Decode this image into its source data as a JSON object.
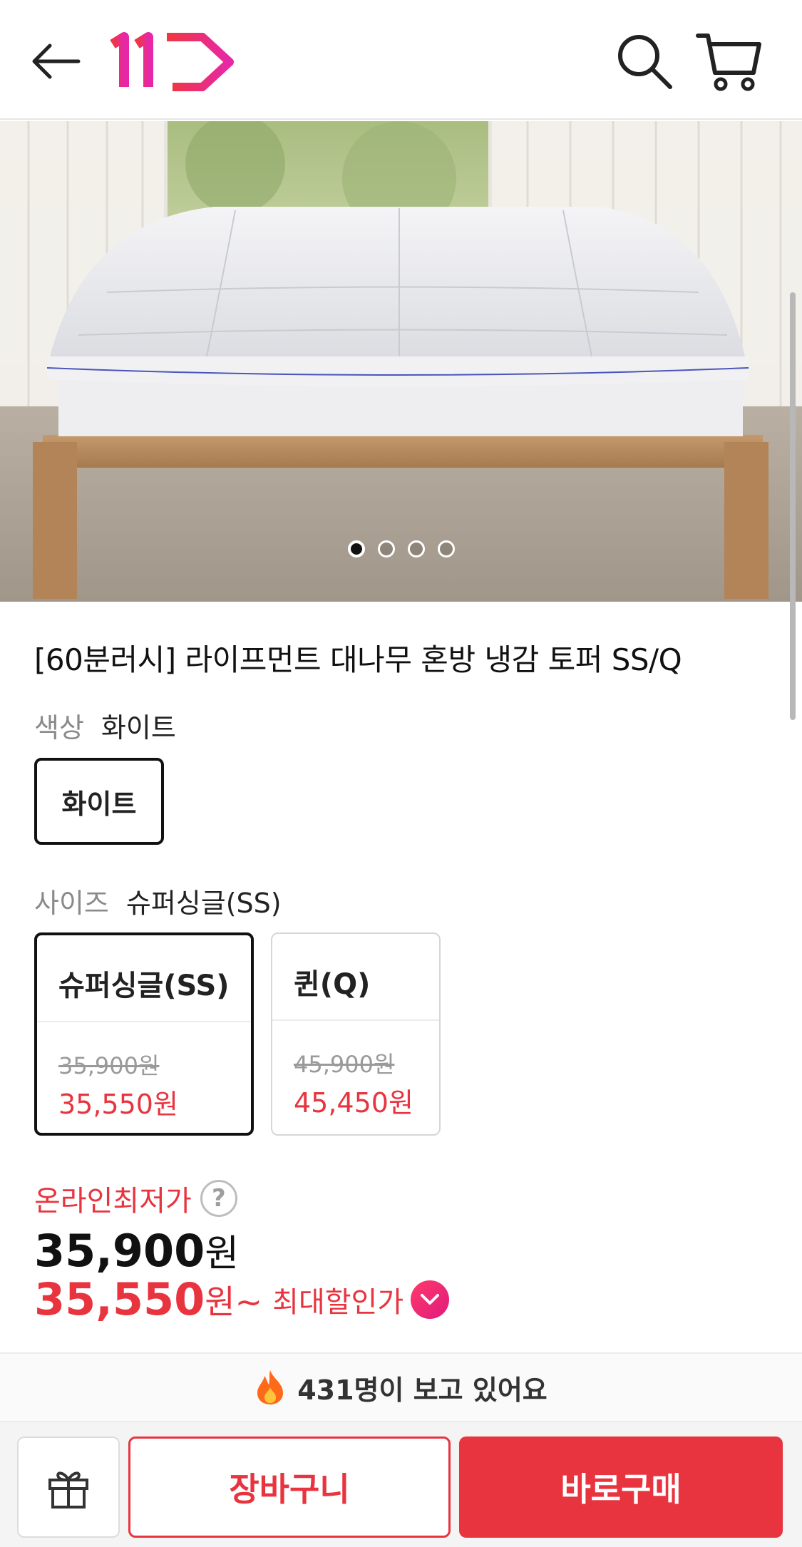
{
  "header": {
    "back_icon": "arrow-left-icon",
    "logo_text": "11",
    "search_icon": "search-icon",
    "cart_icon": "cart-icon"
  },
  "hero": {
    "image_subject": "mattress topper on wooden bed frame",
    "carousel": {
      "total": 4,
      "active_index": 0
    }
  },
  "product": {
    "title": "[60분러시] 라이프먼트 대나무 혼방 냉감 토퍼 SS/Q",
    "color_label": "색상",
    "color_value": "화이트",
    "color_options": [
      "화이트"
    ],
    "size_label": "사이즈",
    "size_value": "슈퍼싱글(SS)",
    "size_options": [
      {
        "name": "슈퍼싱글(SS)",
        "original": "35,900원",
        "sale": "35,550원",
        "selected": true
      },
      {
        "name": "퀸(Q)",
        "original": "45,900원",
        "sale": "45,450원",
        "selected": false
      }
    ]
  },
  "price": {
    "lowest_label": "온라인최저가",
    "help_icon": "question-circle-icon",
    "main_number": "35,900",
    "main_unit": "원",
    "sale_number": "35,550",
    "sale_unit": "원~",
    "max_discount_label": "최대할인가",
    "expand_icon": "chevron-down-icon"
  },
  "viewers": {
    "icon": "fire-icon",
    "text": "431명이 보고 있어요"
  },
  "bottom_bar": {
    "gift_icon": "gift-icon",
    "cart_label": "장바구니",
    "buy_label": "바로구매"
  },
  "colors": {
    "accent": "#e8343f",
    "logo_gradient_start": "#f0363f",
    "logo_gradient_end": "#e628a8"
  }
}
